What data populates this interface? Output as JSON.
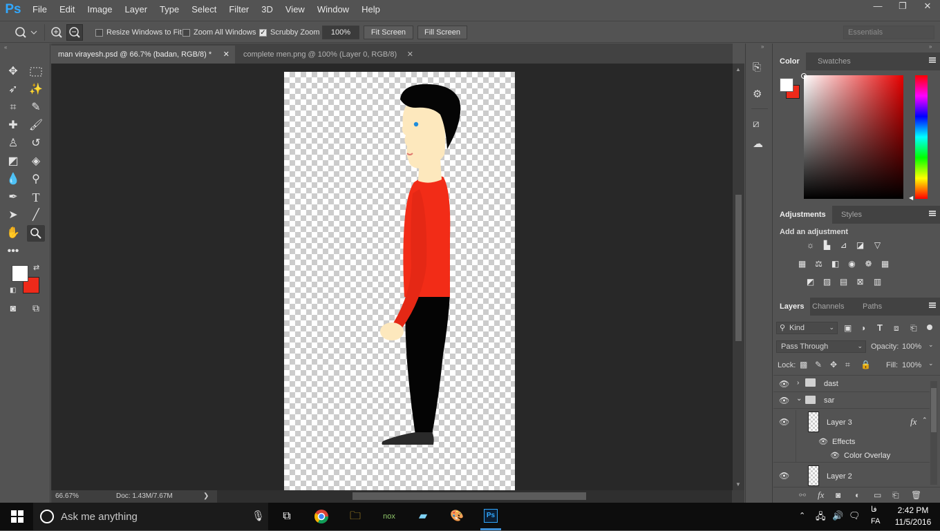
{
  "app": {
    "logo": "Ps"
  },
  "menu": [
    "File",
    "Edit",
    "Image",
    "Layer",
    "Type",
    "Select",
    "Filter",
    "3D",
    "View",
    "Window",
    "Help"
  ],
  "window_controls": {
    "minimize": "—",
    "restore": "❐",
    "close": "✕"
  },
  "options": {
    "resize_windows": {
      "label": "Resize Windows to Fit",
      "checked": false
    },
    "zoom_all": {
      "label": "Zoom All Windows",
      "checked": false
    },
    "scrubby": {
      "label": "Scrubby Zoom",
      "checked": true,
      "mark": "✓"
    },
    "zoom_value": "100%",
    "fit_screen": "Fit Screen",
    "fill_screen": "Fill Screen",
    "workspace": "Essentials"
  },
  "tabs": [
    {
      "label": "man virayesh.psd @ 66.7% (badan, RGB/8) *",
      "close": "✕"
    },
    {
      "label": "complete men.png @ 100% (Layer 0, RGB/8)",
      "close": "✕"
    }
  ],
  "status": {
    "zoom": "66.67%",
    "doc": "Doc: 1.43M/7.67M",
    "arrow": "❯"
  },
  "colors": {
    "foreground": "#ffffff",
    "background": "#ee2a1a",
    "shirt": "#f22c17",
    "skin": "#fde8bd",
    "hair": "#050505",
    "pants": "#040404"
  },
  "color_panel": {
    "tabs": [
      "Color",
      "Swatches"
    ]
  },
  "adjustments_panel": {
    "tabs": [
      "Adjustments",
      "Styles"
    ],
    "heading": "Add an adjustment",
    "icons": [
      [
        "brightness-icon",
        "levels-icon",
        "curves-icon",
        "exposure-icon",
        "vibrance-icon"
      ],
      [
        "hue-sat-icon",
        "color-balance-icon",
        "bw-icon",
        "photo-filter-icon",
        "channel-mixer-icon",
        "color-lookup-icon"
      ],
      [
        "invert-icon",
        "posterize-icon",
        "threshold-icon",
        "selective-color-icon",
        "gradient-map-icon"
      ]
    ]
  },
  "layers_panel": {
    "tabs": [
      "Layers",
      "Channels",
      "Paths"
    ],
    "filter_kind": "Kind",
    "blend_mode": "Pass Through",
    "opacity_label": "Opacity:",
    "opacity_value": "100%",
    "lock_label": "Lock:",
    "fill_label": "Fill:",
    "fill_value": "100%",
    "layers": [
      {
        "name": "dast",
        "type": "group",
        "expanded": false
      },
      {
        "name": "sar",
        "type": "group",
        "expanded": true
      },
      {
        "name": "Layer 3",
        "type": "layer",
        "fx": "fx"
      },
      {
        "name": "Effects",
        "type": "effects"
      },
      {
        "name": "Color Overlay",
        "type": "effect"
      },
      {
        "name": "Layer 2",
        "type": "layer"
      }
    ]
  },
  "taskbar": {
    "search_placeholder": "Ask me anything",
    "time": "2:42 PM",
    "date": "11/5/2016",
    "lang": "FA",
    "lang_native": "فا"
  }
}
